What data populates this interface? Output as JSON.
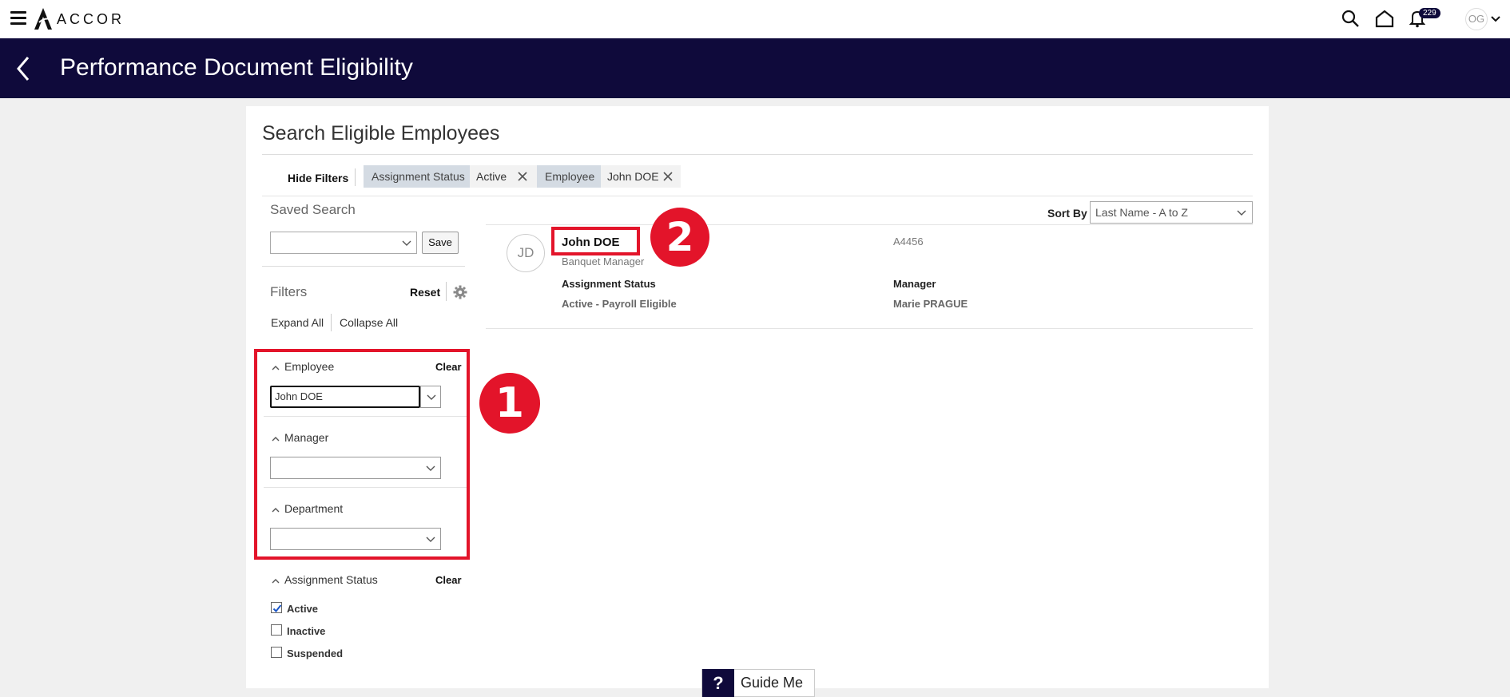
{
  "brand": {
    "logo_text": "ACCOR"
  },
  "topbar": {
    "notifications_count": "229",
    "user_initials": "OG"
  },
  "header": {
    "title": "Performance Document Eligibility"
  },
  "search": {
    "title": "Search Eligible Employees",
    "hide_filters_label": "Hide Filters",
    "chips": [
      {
        "key": "Assignment Status",
        "value": "Active"
      },
      {
        "key": "Employee",
        "value": "John DOE"
      }
    ],
    "sort_by_label": "Sort By",
    "sort_by_value": "Last Name - A to Z"
  },
  "saved_search": {
    "title": "Saved Search",
    "save_label": "Save"
  },
  "filters": {
    "title": "Filters",
    "reset_label": "Reset",
    "expand_all_label": "Expand All",
    "collapse_all_label": "Collapse All",
    "employee": {
      "label": "Employee",
      "clear_label": "Clear",
      "value": "John DOE"
    },
    "manager": {
      "label": "Manager"
    },
    "department": {
      "label": "Department"
    },
    "assignment_status": {
      "label": "Assignment Status",
      "clear_label": "Clear",
      "options": [
        {
          "label": "Active",
          "checked": true
        },
        {
          "label": "Inactive",
          "checked": false
        },
        {
          "label": "Suspended",
          "checked": false
        }
      ]
    }
  },
  "result": {
    "initials": "JD",
    "name": "John DOE",
    "job": "Banquet Manager",
    "id": "A4456",
    "assignment_status_label": "Assignment Status",
    "assignment_status_value": "Active - Payroll Eligible",
    "manager_label": "Manager",
    "manager_value": "Marie PRAGUE"
  },
  "markers": {
    "one": "1",
    "two": "2"
  },
  "guide": {
    "icon": "?",
    "label": "Guide Me"
  },
  "colors": {
    "header_bg": "#0f0a3b",
    "highlight": "#e3142a"
  }
}
